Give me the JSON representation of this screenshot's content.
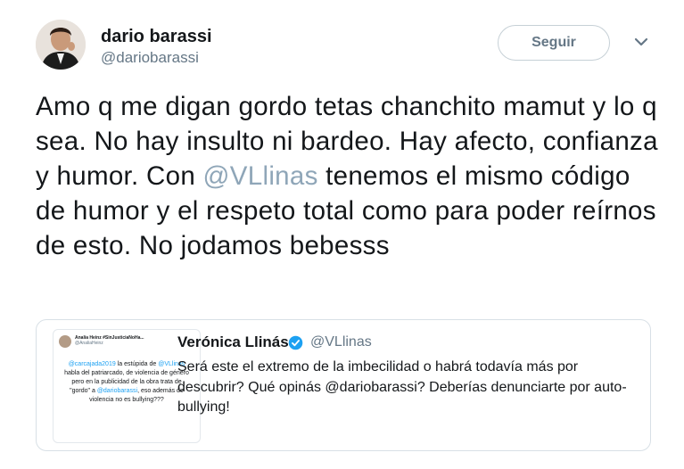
{
  "author": {
    "name": "dario barassi",
    "handle": "@dariobarassi",
    "follow_label": "Seguir"
  },
  "tweet": {
    "text_1": "Amo q me digan gordo tetas chanchito mamut y lo q sea. No hay insulto ni bardeo. Hay afecto, confianza y humor. Con ",
    "mention": "@VLlinas",
    "text_2": " tenemos el mismo código de humor y el respeto total como para poder reírnos de esto. No jodamos bebesss"
  },
  "quoted_tweet": {
    "name": "Verónica Llinás",
    "handle": "@VLlinas",
    "text": "Será este el extremo de la imbecilidad o habrá todavía más por descubrir? Qué opinás @dariobarassi? Deberías denunciarte por auto-bullying!",
    "thumbnail": {
      "meta_name": "Analía Heinz #SinJusticiaNoHa...",
      "meta_handle": "@AnaliaHeinz",
      "text_mention_1": "@carcajada2019",
      "text_1": " la estúpida de ",
      "text_mention_2": "@VLlinas",
      "text_2": " habla del patriarcado, de violencia de género pero en la publicidad de la obra trata de \"gordo\" a ",
      "text_mention_3": "@dariobarassi",
      "text_3": ", eso además de violencia no es bullying???"
    }
  },
  "colors": {
    "text": "#14171a",
    "secondary": "#657786",
    "mention": "#8fa6b8",
    "verified": "#1da1f2",
    "border": "#d8e0e6"
  }
}
